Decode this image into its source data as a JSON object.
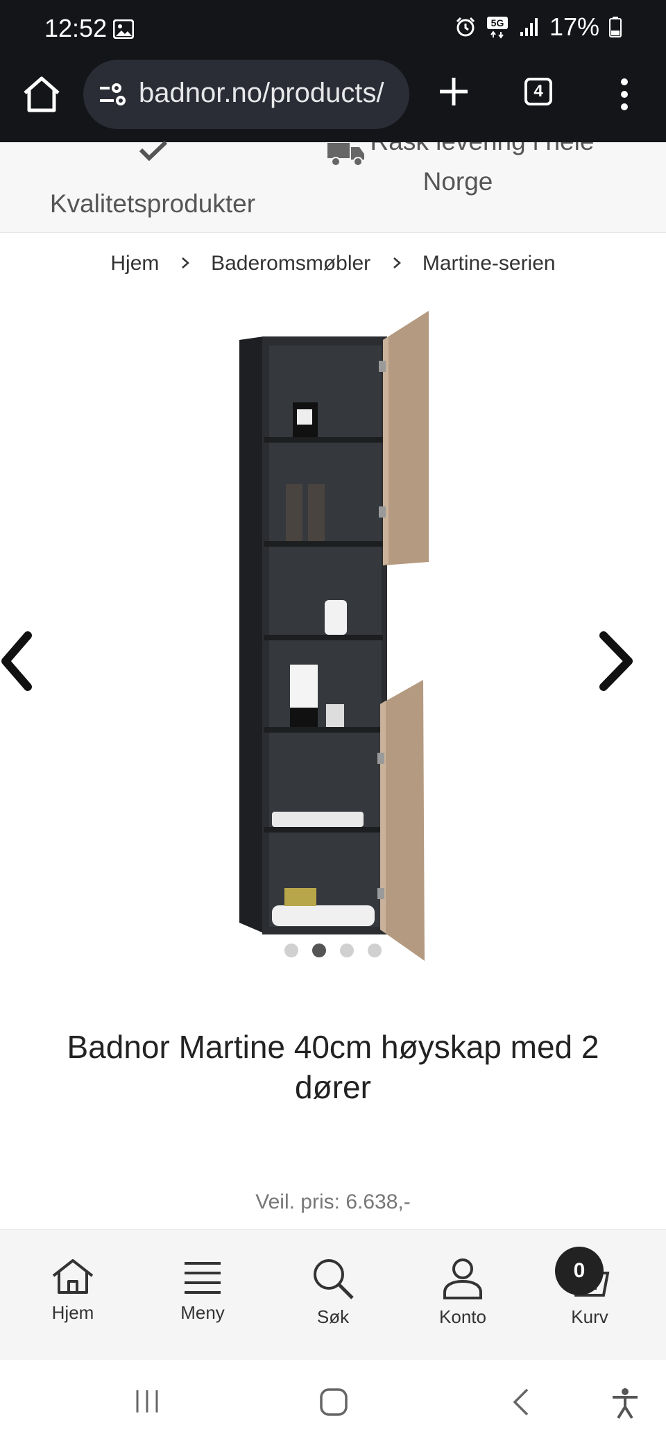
{
  "status": {
    "time": "12:52",
    "network": "5G",
    "battery": "17%"
  },
  "browser": {
    "url": "badnor.no/products/",
    "tab_count": "4"
  },
  "usp": {
    "item1": "Kvalitetsprodukter",
    "item2_line1": "Rask levering i hele",
    "item2_line2": "Norge"
  },
  "breadcrumb": {
    "home": "Hjem",
    "category": "Baderomsmøbler",
    "series": "Martine-serien"
  },
  "gallery": {
    "slides": 4,
    "active_index": 1
  },
  "product": {
    "title": "Badnor Martine 40cm høyskap med 2 dører",
    "recommended_price": "Veil. pris: 6.638,-"
  },
  "bottom_nav": {
    "home": "Hjem",
    "menu": "Meny",
    "search": "Søk",
    "account": "Konto",
    "cart": "Kurv",
    "cart_count": "0"
  },
  "colors": {
    "chrome_bg": "#141519",
    "urlbar_bg": "#2a2d36",
    "cabinet_dark": "#2b2d30",
    "door_wood": "#b49a80"
  },
  "icons": {
    "status": [
      "image-icon",
      "alarm-icon",
      "5g-icon",
      "signal-icon",
      "battery-icon"
    ],
    "browser": [
      "home-icon",
      "site-settings-icon",
      "plus-icon",
      "tabs-icon",
      "more-vert-icon"
    ],
    "gallery": [
      "chevron-left-icon",
      "chevron-right-icon"
    ],
    "bottom_nav": [
      "home-icon",
      "menu-icon",
      "search-icon",
      "account-icon",
      "cart-icon"
    ],
    "system": [
      "recents-icon",
      "home-icon",
      "back-icon",
      "accessibility-icon"
    ]
  }
}
